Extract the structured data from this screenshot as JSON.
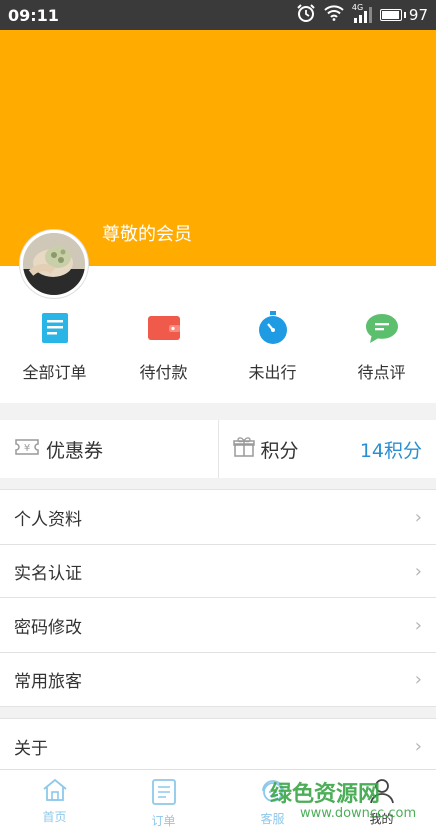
{
  "status_bar": {
    "time": "09:11",
    "network": "4G",
    "battery": "97"
  },
  "header": {
    "member_label": "尊敬的会员"
  },
  "orders": [
    {
      "label": "全部订单",
      "icon": "all-orders-icon",
      "color": "#29b6e6"
    },
    {
      "label": "待付款",
      "icon": "wallet-icon",
      "color": "#ef5a4a"
    },
    {
      "label": "未出行",
      "icon": "stopwatch-icon",
      "color": "#1e9be3"
    },
    {
      "label": "待点评",
      "icon": "comment-icon",
      "color": "#5cbf6e"
    }
  ],
  "coupons": {
    "label": "优惠券"
  },
  "points": {
    "label": "积分",
    "value": "14积分"
  },
  "menu_group_1": [
    "个人资料",
    "实名认证"
  ],
  "menu_group_2": [
    "密码修改",
    "常用旅客"
  ],
  "menu_group_3": [
    "关于"
  ],
  "tabbar": [
    {
      "label": "首页",
      "icon": "home-icon"
    },
    {
      "label": "订单",
      "icon": "order-list-icon"
    },
    {
      "label": "客服",
      "icon": "customer-service-icon"
    },
    {
      "label": "我的",
      "icon": "profile-icon",
      "active": true
    }
  ],
  "watermark": {
    "main": "绿色资源网",
    "sub": "www.downcc.com"
  },
  "colors": {
    "header": "#ffab00",
    "accent": "#2a8fd0"
  }
}
